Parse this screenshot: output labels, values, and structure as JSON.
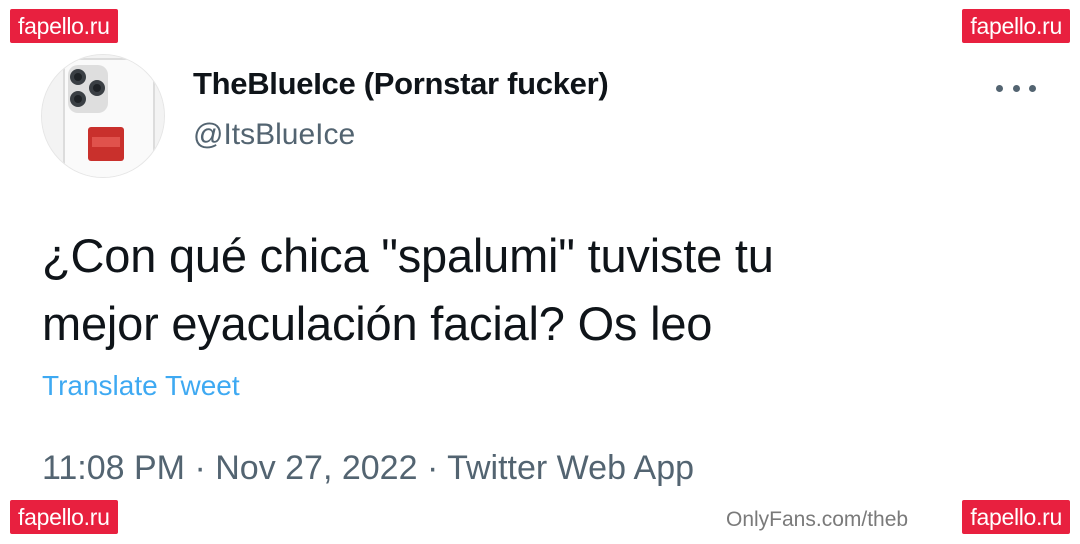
{
  "watermarks": {
    "top_left": "fapello.ru",
    "top_right": "fapello.ru",
    "bottom_left": "fapello.ru",
    "bottom_right": "fapello.ru"
  },
  "tweet": {
    "display_name": "TheBlueIce (Pornstar fucker)",
    "handle": "@ItsBlueIce",
    "text_line1": "¿Con qué chica \"spalumi\" tuviste tu",
    "text_line2": "mejor eyaculación facial? Os leo",
    "translate_label": "Translate Tweet",
    "time": "11:08 PM",
    "date": "Nov 27, 2022",
    "source": "Twitter Web App",
    "separator": " · "
  },
  "footer": {
    "onlyfans_text": "OnlyFans.com/theb"
  },
  "icons": {
    "more": "more-options-icon",
    "avatar": "avatar"
  },
  "colors": {
    "watermark_bg": "#e8203f",
    "link": "#1d9bf0",
    "secondary_text": "#536471",
    "primary_text": "#0f1419"
  }
}
